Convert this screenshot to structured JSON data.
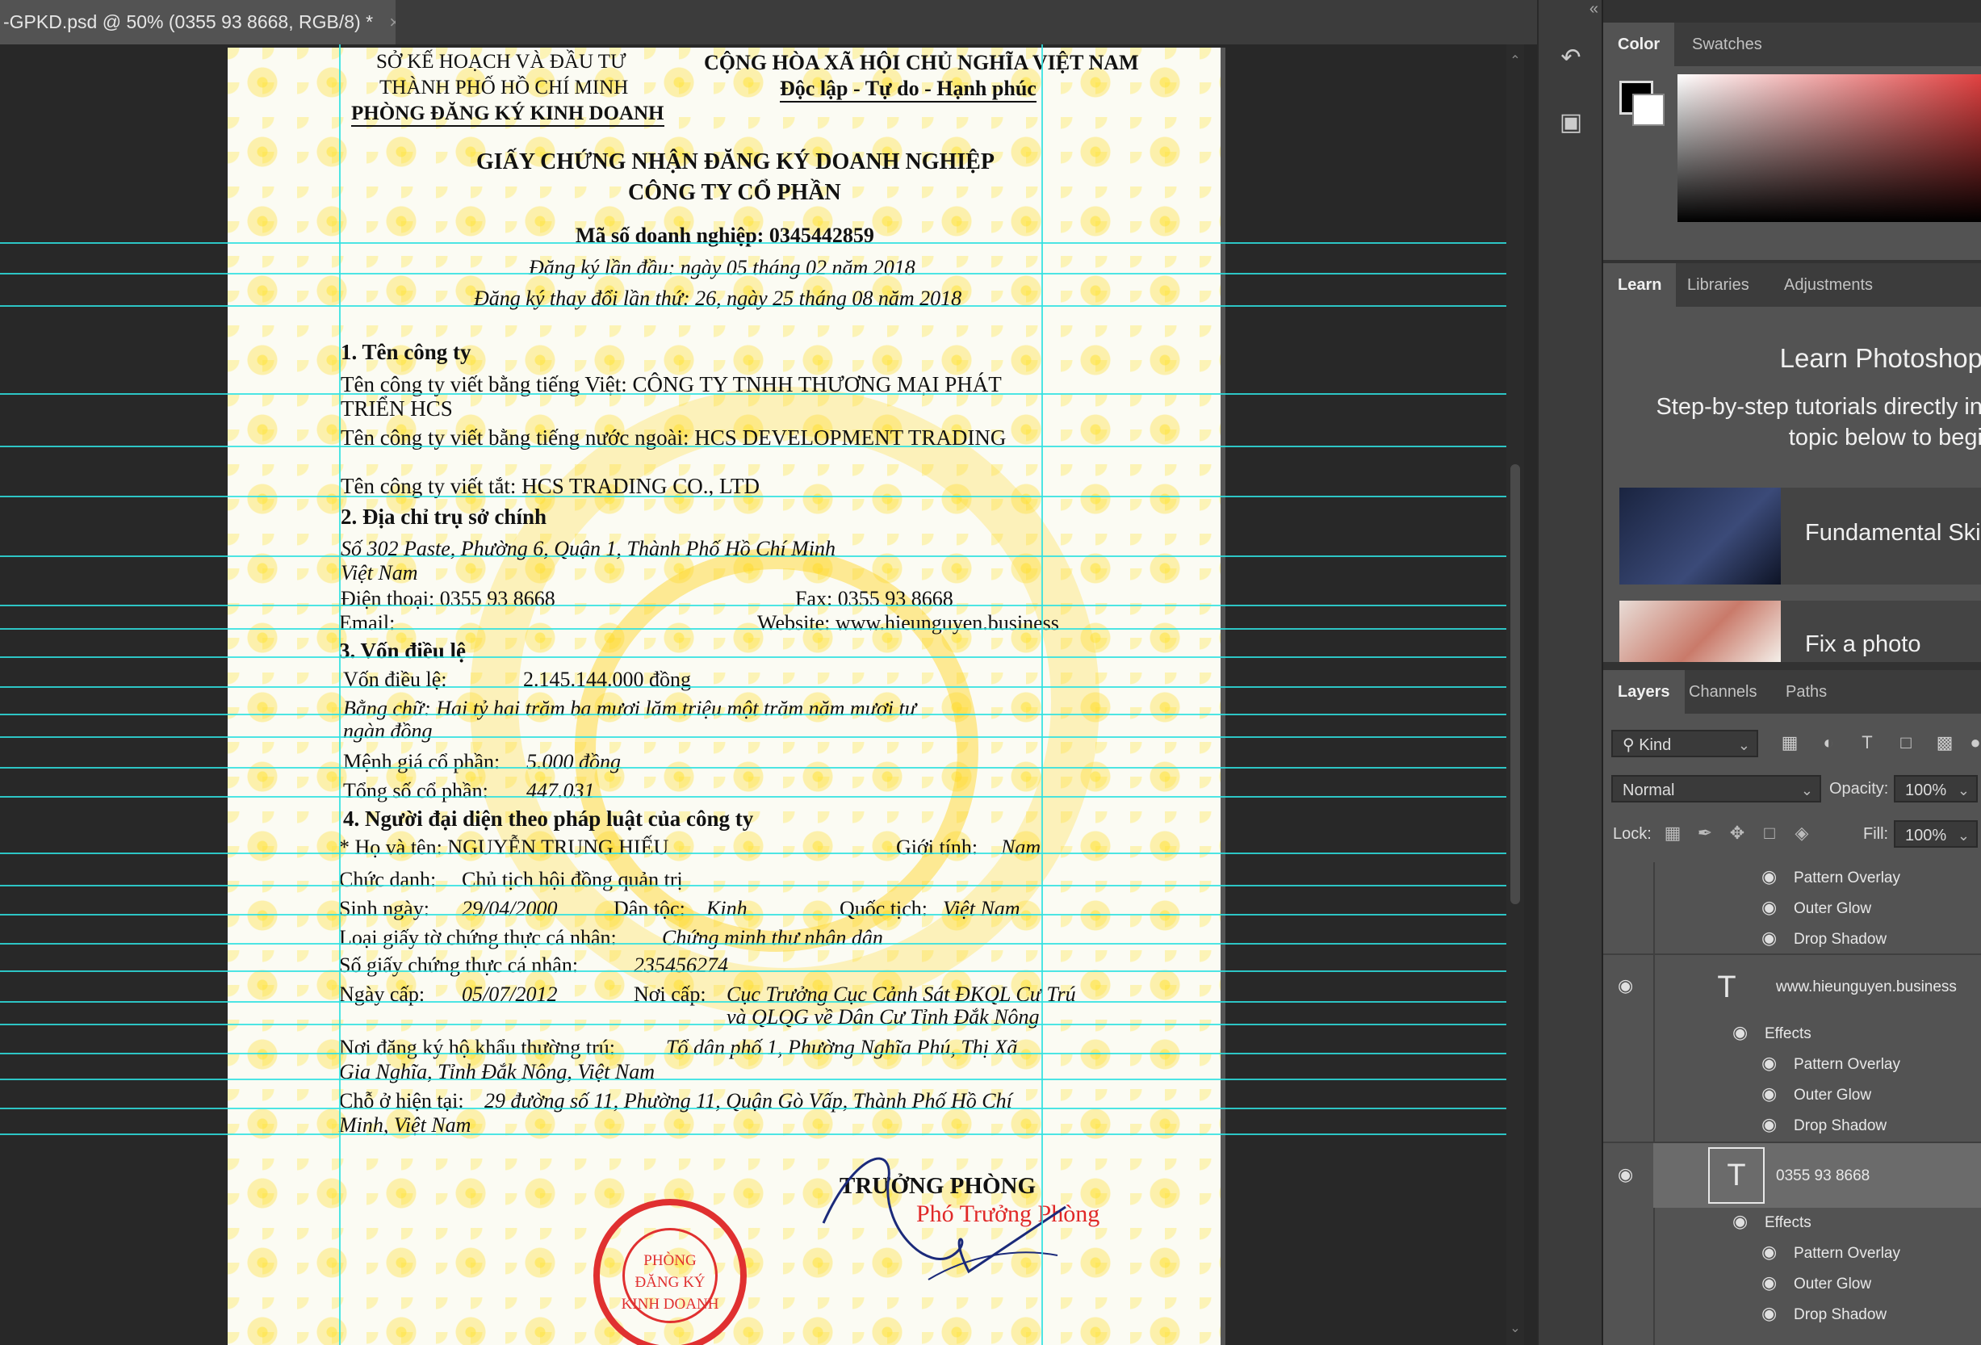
{
  "document_tab": {
    "title": "-GPKD.psd @ 50% (0355 93 8668, RGB/8) *",
    "close": "×"
  },
  "certificate": {
    "agency_line1": "SỞ KẾ HOẠCH VÀ ĐẦU TƯ",
    "agency_line2": "THÀNH PHỐ HỒ CHÍ MINH",
    "agency_line3": "PHÒNG ĐĂNG KÝ KINH DOANH",
    "nation": "CỘNG HÒA XÃ HỘI CHỦ NGHĨA VIỆT NAM",
    "motto": "Độc lập - Tự do - Hạnh phúc",
    "title1": "GIẤY CHỨNG NHẬN ĐĂNG KÝ DOANH NGHIỆP",
    "title2": "CÔNG TY CỔ PHẦN",
    "tax_code": "Mã số doanh nghiệp: 0345442859",
    "first_reg": "Đăng ký lần đầu: ngày 05 tháng 02 năm 2018",
    "change_reg": "Đăng ký thay đổi lần thứ:  26, ngày 25 tháng 08 năm 2018",
    "s1_heading": "1. Tên công ty",
    "name_vn_1": "Tên công ty viết bằng tiếng Việt: CÔNG TY TNHH THƯƠNG MẠI PHÁT",
    "name_vn_2": "TRIỂN HCS",
    "name_foreign": "Tên công ty viết bằng tiếng nước ngoài: HCS DEVELOPMENT TRADING",
    "name_short": "Tên công ty viết tắt: HCS TRADING CO., LTD",
    "s2_heading": "2. Địa chỉ trụ sở chính",
    "address1": "Số 302 Paste, Phường 6, Quận 1, Thành Phố Hồ Chí Minh",
    "address2": "Việt Nam",
    "phone": "Điện thoại: 0355 93 8668",
    "fax": "Fax: 0355 93 8668",
    "email": "Email:",
    "website": "Website: www.hieunguyen.business",
    "s3_heading": "3. Vốn điều lệ",
    "capital_label": "Vốn điều lệ:",
    "capital_value": "2.145.144.000 đồng",
    "in_words_1": "Bằng chữ: Hai tỷ hai trăm ba mươi lăm triệu một trăm năm mươi tư",
    "in_words_2": "ngàn đồng",
    "par_label": "Mệnh giá cổ phần:",
    "par_value": "5.000 đồng",
    "shares_label": "Tổng số cổ phần:",
    "shares_value": "447.031",
    "s4_heading": "4. Người đại diện theo pháp luật của công ty",
    "rep_name": "*   Họ và tên: NGUYỄN TRUNG HIẾU",
    "gender_label": "Giới tính:",
    "gender_value": "Nam",
    "position_label": "Chức danh:",
    "position_value": "Chủ tịch hội đồng quản trị",
    "dob_label": "Sinh ngày:",
    "dob_value": "29/04/2000",
    "ethnic_label": "Dân tộc:",
    "ethnic_value": "Kinh",
    "nation_label": "Quốc tịch:",
    "nation_value": "Việt Nam",
    "idtype_label": "Loại giấy tờ chứng thực cá nhân:",
    "idtype_value": "Chứng minh thư nhân dân",
    "idno_label": "Số giấy chứng thực cá nhân:",
    "idno_value": "235456274",
    "issue_label": "Ngày cấp:",
    "issue_value": "05/07/2012",
    "place_label": "Nơi cấp:",
    "place_value1": "Cục Trưởng Cục Cảnh Sát ĐKQL Cư Trú",
    "place_value2": "và QLQG về Dân Cư Tỉnh Đắk Nông",
    "residence_label": "Nơi đăng ký hộ khẩu thường trú:",
    "residence_value1": "Tổ dân phố 1, Phường Nghĩa Phú, Thị Xã",
    "residence_value2": "Gia Nghĩa, Tỉnh Đắk Nông, Việt Nam",
    "current_label": "Chỗ ở hiện tại:",
    "current_value1": "29 đường số 11, Phường 11, Quận Gò Vấp, Thành Phố Hồ Chí",
    "current_value2": "Minh, Việt Nam",
    "sign_title": "TRƯỞNG PHÒNG",
    "sign_deputy": "Phó Trưởng Phòng",
    "stamp_text": "PHÒNG\nĐĂNG KÝ\nKINH DOANH"
  },
  "color_panel": {
    "tabs": [
      "Color",
      "Swatches"
    ],
    "fg": "#000000",
    "bg": "#ffffff"
  },
  "learn_panel": {
    "tabs": [
      "Learn",
      "Libraries",
      "Adjustments"
    ],
    "title": "Learn Photoshop",
    "subtitle1": "Step-by-step tutorials directly in",
    "subtitle2": "topic below to begi",
    "cards": [
      "Fundamental Ski",
      "Fix a photo"
    ]
  },
  "layers_panel": {
    "tabs": [
      "Layers",
      "Channels",
      "Paths"
    ],
    "filter": "Kind",
    "blend_mode": "Normal",
    "opacity_label": "Opacity:",
    "opacity": "100%",
    "lock_label": "Lock:",
    "fill_label": "Fill:",
    "fill": "100%",
    "effects_label": "Effects",
    "effect_names": [
      "Pattern Overlay",
      "Outer Glow",
      "Drop Shadow"
    ],
    "layers": [
      {
        "name": "www.hieunguyen.business",
        "type": "text"
      },
      {
        "name": "0355 93 8668",
        "type": "text",
        "selected": true
      }
    ]
  },
  "colors": {
    "accent_guide": "#2ee0e0",
    "stamp_red": "#e03030",
    "panel_bg": "#535353"
  }
}
